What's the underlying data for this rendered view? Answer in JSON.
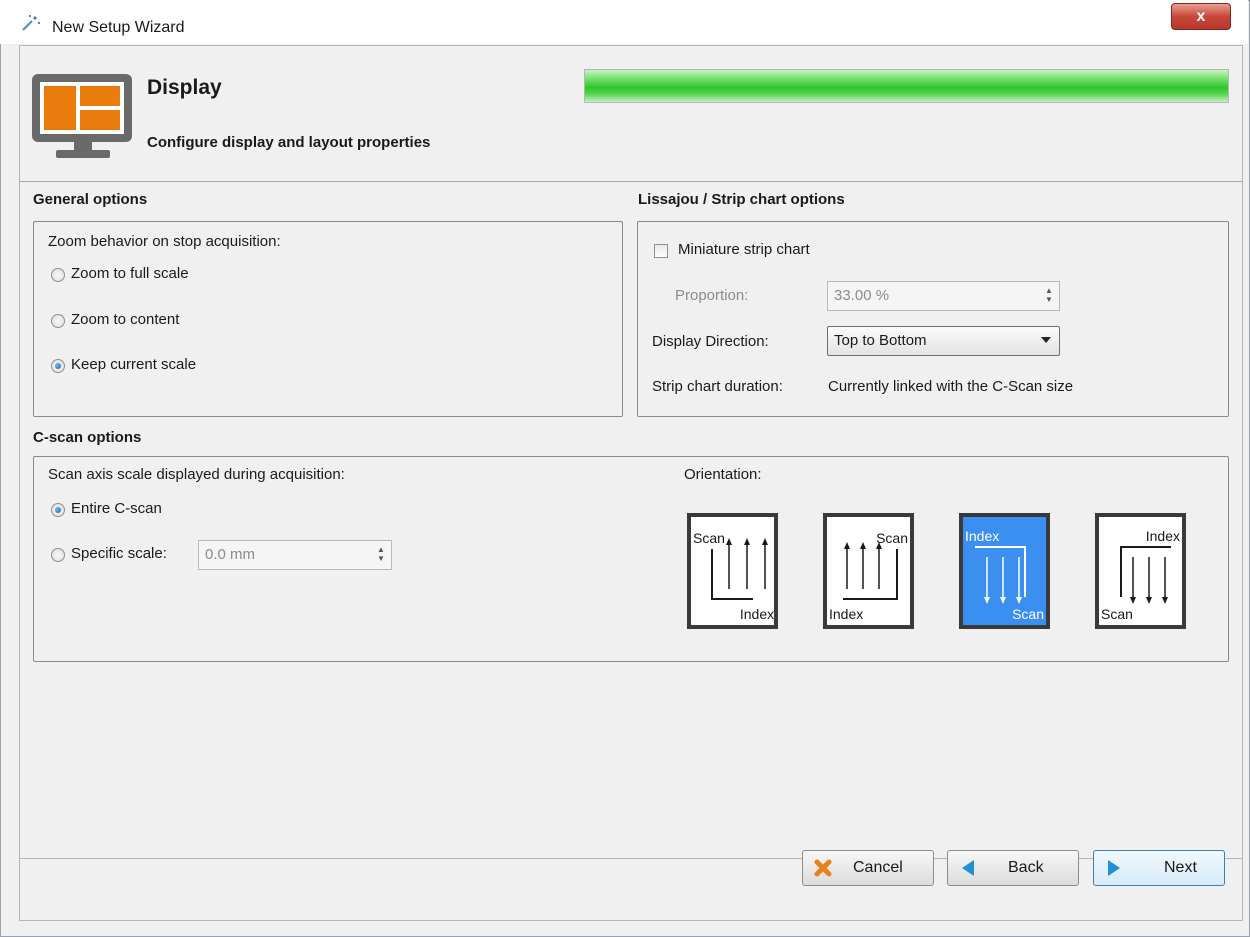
{
  "window": {
    "title": "New Setup Wizard",
    "close_label": "x"
  },
  "header": {
    "title": "Display",
    "subtitle": "Configure display and layout properties",
    "progress": 1.0,
    "progress_color": "#2fc52a"
  },
  "general": {
    "title": "General options",
    "zoom_label": "Zoom behavior on stop acquisition:",
    "options": [
      "Zoom to full scale",
      "Zoom to content",
      "Keep current scale"
    ],
    "selected_index": 2
  },
  "lissajou": {
    "title": "Lissajou / Strip chart options",
    "miniature_label": "Miniature strip chart",
    "miniature_checked": false,
    "proportion_label": "Proportion:",
    "proportion_value": "33.00 %",
    "direction_label": "Display Direction:",
    "direction_value": "Top to Bottom",
    "duration_label": "Strip chart duration:",
    "duration_value": "Currently linked with the C-Scan size"
  },
  "cscan": {
    "title": "C-scan options",
    "axis_label": "Scan axis scale displayed during acquisition:",
    "entire_label": "Entire C-scan",
    "specific_label": "Specific scale:",
    "specific_value": "0.0 mm",
    "selected": "entire",
    "orientation_label": "Orientation:",
    "orientations": [
      {
        "a": "Scan",
        "b": "Index"
      },
      {
        "a": "Scan",
        "b": "Index"
      },
      {
        "a": "Index",
        "b": "Scan"
      },
      {
        "a": "Index",
        "b": "Scan"
      }
    ],
    "orientation_selected": 2,
    "selected_color": "#3a8ff0"
  },
  "footer": {
    "cancel": "Cancel",
    "back": "Back",
    "next": "Next"
  },
  "colors": {
    "accent_orange": "#e87b0c",
    "monitor_gray": "#6a6a6a",
    "button_blue": "#1f8fd6",
    "cancel_orange": "#e8811c"
  }
}
